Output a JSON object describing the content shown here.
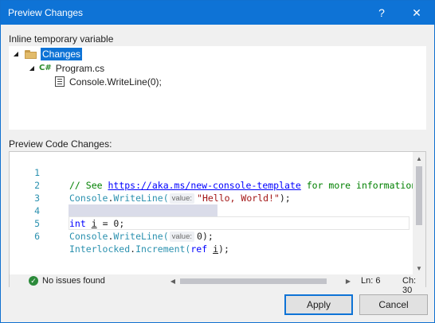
{
  "window": {
    "title": "Preview Changes",
    "help_label": "?",
    "close_label": "✕"
  },
  "tree": {
    "section_label": "Inline temporary variable",
    "root": {
      "label": "Changes",
      "selected": true,
      "icon": "folder-icon"
    },
    "file": {
      "label": "Program.cs",
      "badge": "C#"
    },
    "change": {
      "label": "Console.WriteLine(0);",
      "icon": "method-icon"
    }
  },
  "preview": {
    "section_label": "Preview Code Changes:",
    "lines": [
      {
        "number": "1",
        "comment": "// See ",
        "link": "https://aka.ms/new-console-template",
        "comment_rest": " for more information"
      },
      {
        "number": "2",
        "type": "Console",
        "dot": ".",
        "method": "WriteLine(",
        "hint": "value:",
        "string": "\"Hello, World!\"",
        "end": ");"
      },
      {
        "number": "3"
      },
      {
        "number": "4",
        "keyword": "int",
        "space": " ",
        "var": "i",
        "rest": " = 0;"
      },
      {
        "number": "5",
        "type": "Console",
        "dot": ".",
        "method": "WriteLine(",
        "hint": "value:",
        "arg": "0",
        "end": ");"
      },
      {
        "number": "6",
        "type": "Interlocked",
        "dot": ".",
        "method": "Increment(",
        "keyword": "ref",
        "space": " ",
        "var": "i",
        "end": ");"
      }
    ]
  },
  "status": {
    "message": "No issues found",
    "ok_icon": "✓",
    "line": "Ln: 6",
    "column": "Ch: 30"
  },
  "buttons": {
    "apply": "Apply",
    "cancel": "Cancel"
  }
}
